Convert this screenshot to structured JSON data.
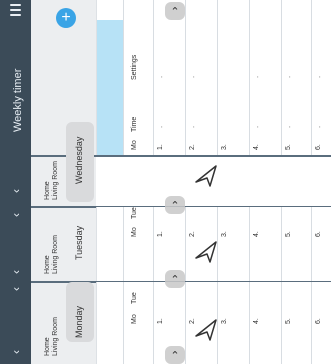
{
  "app": {
    "title": "Weekly timer",
    "add_label": "+"
  },
  "panels": [
    {
      "day": "Wednesday",
      "home": "Home",
      "room": "Living Room",
      "header_cols": [
        "Mo",
        "Time",
        "Settings"
      ],
      "rows": [
        "1.",
        "2.",
        "3.",
        "4.",
        "5.",
        "6."
      ]
    },
    {
      "day": "Tuesday",
      "home": "Home",
      "room": "Living Room",
      "header_cols": [
        "Mo",
        "Tue"
      ],
      "rows": [
        "1.",
        "2.",
        "3.",
        "4.",
        "5.",
        "6."
      ]
    },
    {
      "day": "Monday",
      "home": "Home",
      "room": "Living Room",
      "header_cols": [
        "Mo",
        "Tue"
      ],
      "rows": [
        "1.",
        "2.",
        "3.",
        "4.",
        "5.",
        "6."
      ]
    }
  ],
  "placeholder_dash": "-",
  "icons": {
    "menu": "menu-icon",
    "back": "chevron-left-icon",
    "add": "plus-icon",
    "scroll": "chevron-up-icon",
    "cursor": "pointer-cursor-icon"
  },
  "colors": {
    "sidebar": "#3b4b58",
    "accent": "#3aa4e6",
    "highlight": "#b7e2f6"
  }
}
